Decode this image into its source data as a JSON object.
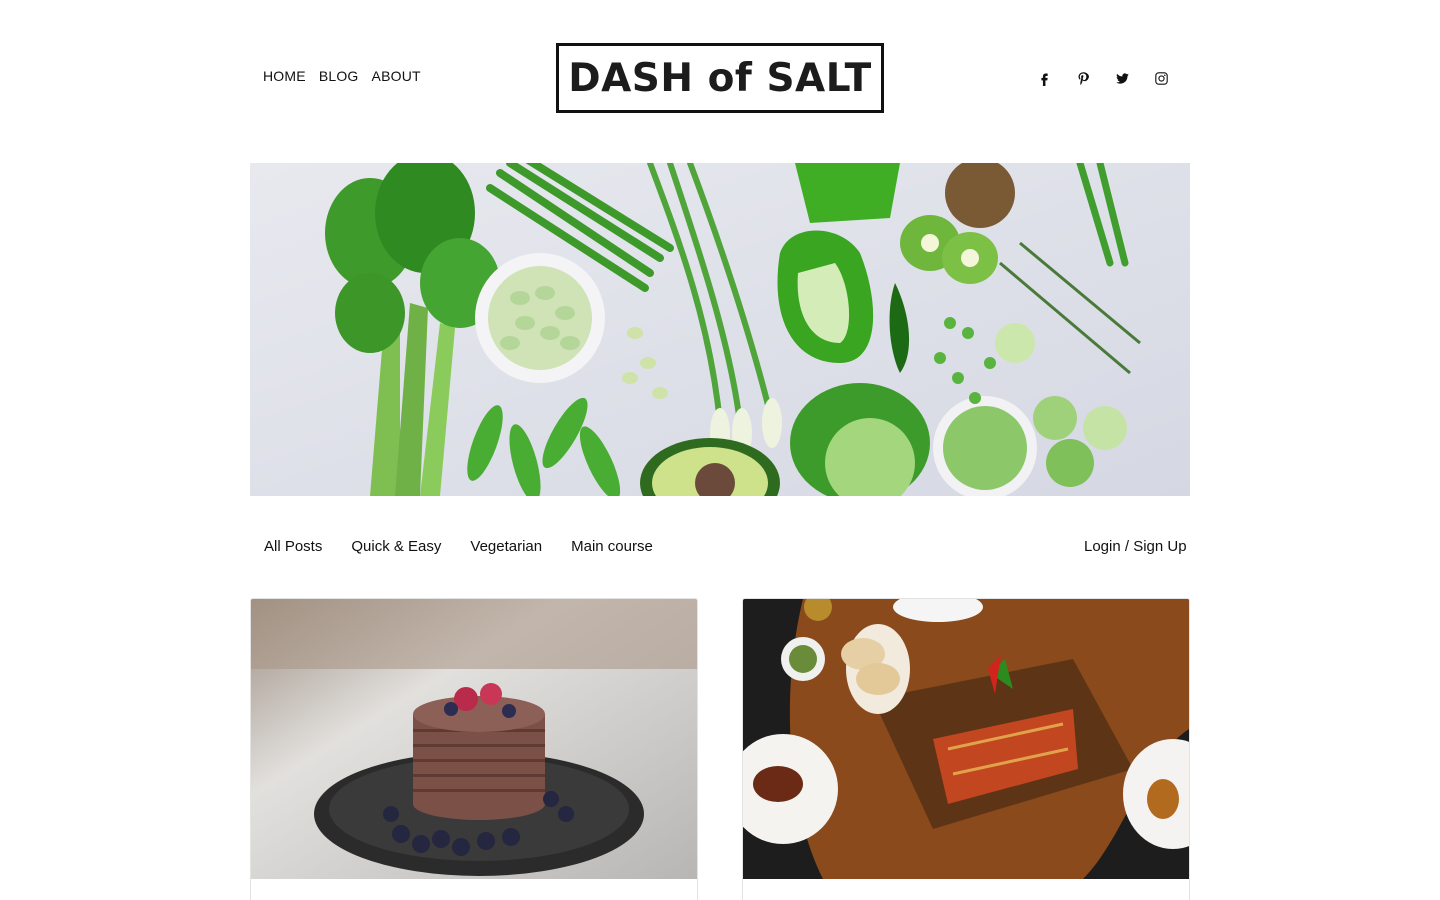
{
  "header": {
    "nav": [
      "HOME",
      "BLOG",
      "ABOUT"
    ],
    "logo": "DASH of SALT",
    "social_icons": [
      "facebook-icon",
      "pinterest-icon",
      "twitter-icon",
      "instagram-icon"
    ]
  },
  "categories": [
    "All Posts",
    "Quick & Easy",
    "Vegetarian",
    "Main course"
  ],
  "login_label": "Login / Sign Up",
  "colors": {
    "text": "#111111",
    "hero_bg": "#dfe1ea",
    "card_border": "#e3e3e3"
  }
}
